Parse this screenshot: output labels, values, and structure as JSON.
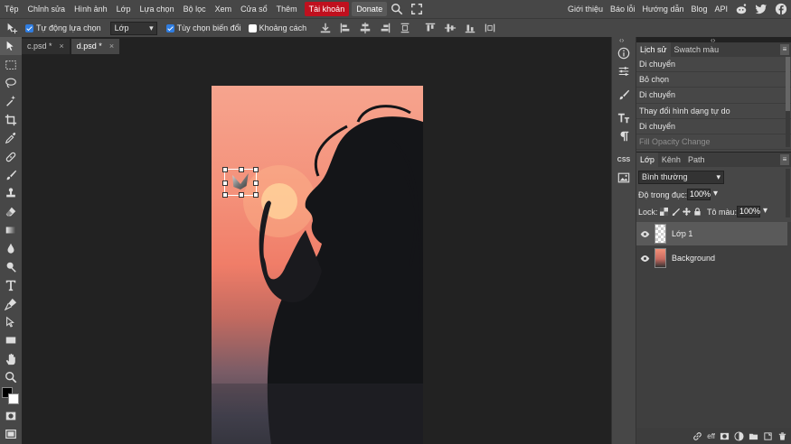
{
  "menubar": {
    "items": [
      "Tệp",
      "Chỉnh sửa",
      "Hình ảnh",
      "Lớp",
      "Lựa chọn",
      "Bộ lọc",
      "Xem",
      "Cửa sổ",
      "Thêm"
    ],
    "account": "Tài khoản",
    "donate": "Donate",
    "right_items": [
      "Giới thiệu",
      "Báo lỗi",
      "Hướng dẫn",
      "Blog",
      "API"
    ],
    "icons": [
      "search-icon",
      "fullscreen-icon",
      "reddit-icon",
      "twitter-icon",
      "facebook-icon"
    ]
  },
  "optionsbar": {
    "auto_select_label": "Tự động lựa chọn",
    "auto_select_checked": true,
    "auto_select_target": "Lớp",
    "transform_controls_label": "Tùy chọn biến đổi",
    "transform_controls_checked": true,
    "distances_label": "Khoảng cách",
    "distances_checked": false
  },
  "tabs": [
    {
      "label": "c.psd *",
      "active": false
    },
    {
      "label": "d.psd *",
      "active": true
    }
  ],
  "history": {
    "tabs": [
      "Lịch sử",
      "Swatch màu"
    ],
    "rows": [
      "Di chuyển",
      "Bỏ chọn",
      "Di chuyển",
      "Thay đổi hình dạng tự do",
      "Di chuyển",
      "Fill Opacity Change"
    ]
  },
  "layers": {
    "tabs": [
      "Lớp",
      "Kênh",
      "Path"
    ],
    "blend_mode": "Bình thường",
    "opacity_label": "Độ trong đục:",
    "opacity_value": "100%",
    "lock_label": "Lock:",
    "fill_label": "Tô màu:",
    "fill_value": "100%",
    "items": [
      {
        "name": "Lớp 1",
        "selected": true
      },
      {
        "name": "Background",
        "selected": false
      }
    ]
  },
  "panel_strip_labels": {
    "css": "CSS"
  },
  "colors": {
    "foreground": "#000000",
    "background": "#ffffff",
    "accent_account": "#c0101e",
    "checkbox": "#2f7de1"
  }
}
